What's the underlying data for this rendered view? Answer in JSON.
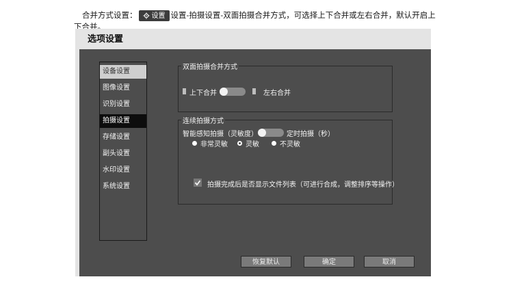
{
  "doc": {
    "line1_before": "合并方式设置：",
    "inline_button": {
      "icon": "gear-icon",
      "label": "设置"
    },
    "line1_after": "设置-拍摄设置-双面拍摄合并方式，可选择上下合并或左右合并，默认开启上",
    "line2": "下合并。"
  },
  "dialog": {
    "title": "选项设置",
    "sidebar": {
      "items": [
        {
          "label": "设备设置",
          "state": "highlighted"
        },
        {
          "label": "图像设置"
        },
        {
          "label": "识别设置"
        },
        {
          "label": "拍摄设置",
          "state": "active"
        },
        {
          "label": "存储设置"
        },
        {
          "label": "副头设置"
        },
        {
          "label": "水印设置"
        },
        {
          "label": "系统设置"
        }
      ]
    },
    "merge_group": {
      "title": "双面拍摄合并方式",
      "left_label": "上下合并",
      "right_label": "左右合并",
      "toggle_value": "上下合并"
    },
    "continuous_group": {
      "title": "连续拍摄方式",
      "left_label": "智能感知拍摄（灵敏度）",
      "right_label": "定时拍摄（秒）",
      "toggle_value": "智能感知拍摄",
      "radios": [
        {
          "label": "非常灵敏",
          "selected": false
        },
        {
          "label": "灵敏",
          "selected": true
        },
        {
          "label": "不灵敏",
          "selected": false
        }
      ],
      "checkbox": {
        "label": "拍摄完成后是否显示文件列表（可进行合成，调整排序等操作）",
        "checked": true
      }
    },
    "buttons": {
      "restore": "恢复默认",
      "ok": "确定",
      "cancel": "取消"
    }
  }
}
